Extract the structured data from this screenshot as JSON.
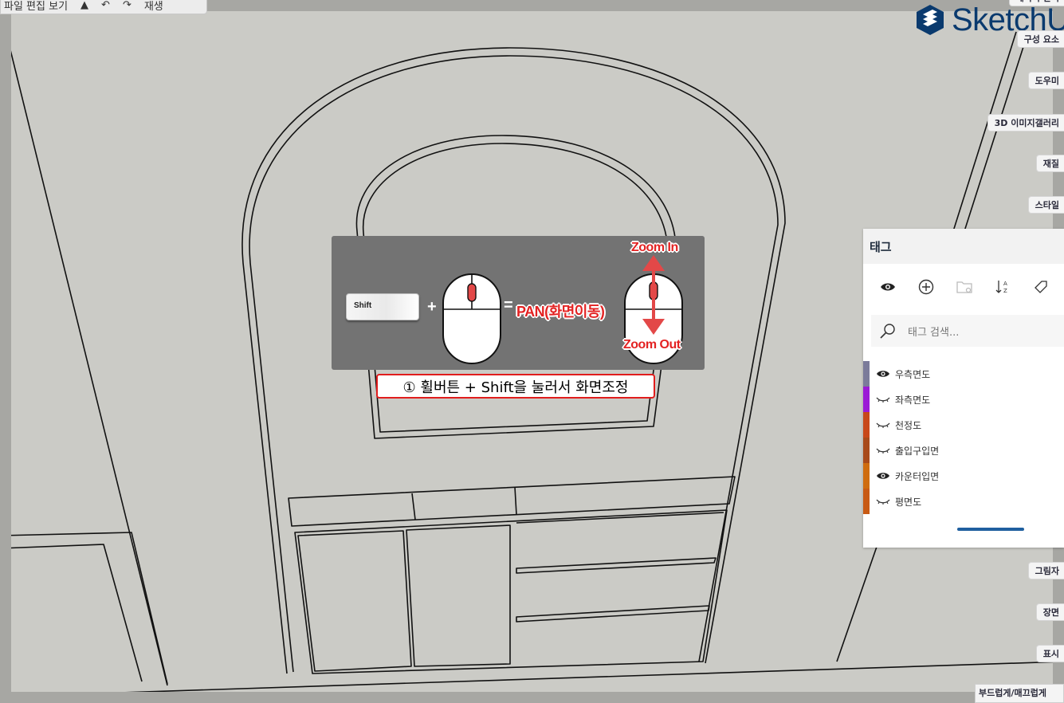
{
  "toolbar": {
    "item1": "파일 편집 보기",
    "item2": "▲",
    "item3": "↶",
    "item4": "↷",
    "item5": "재생"
  },
  "logo": {
    "text": "SketchU"
  },
  "trays": {
    "components": "구성 요소",
    "help": "도우미",
    "gallery": "3D 이미지갤러리",
    "materials": "재질",
    "styles": "스타일",
    "shadows": "그림자",
    "scenes": "장면",
    "display": "표시",
    "top_cut": "레이어 관리"
  },
  "tag_panel": {
    "title": "태그",
    "search_placeholder": "태그 검색...",
    "tags": [
      {
        "name": "우측면도",
        "visible": true,
        "color": "#7b7b9a"
      },
      {
        "name": "좌측면도",
        "visible": false,
        "color": "#9b1ad6"
      },
      {
        "name": "천정도",
        "visible": false,
        "color": "#c8481a"
      },
      {
        "name": "출입구입면",
        "visible": false,
        "color": "#a84a1b"
      },
      {
        "name": "카운터입면",
        "visible": true,
        "color": "#cf6c0f"
      },
      {
        "name": "평면도",
        "visible": false,
        "color": "#c85a14"
      }
    ]
  },
  "instruction": {
    "shift_key": "Shift",
    "plus": "+",
    "equals": "=",
    "pan_label": "PAN(화면이동)",
    "zoom_in": "Zoom In",
    "zoom_out": "Zoom Out",
    "caption": "① 휠버튼 + Shift을 눌러서 화면조정"
  },
  "bottom_tray": {
    "label": "부드럽게/매끄럽게"
  },
  "colors": {
    "accent": "#1f5f9f",
    "highlight_red": "#e32222",
    "logo_blue": "#0a3a6e"
  }
}
